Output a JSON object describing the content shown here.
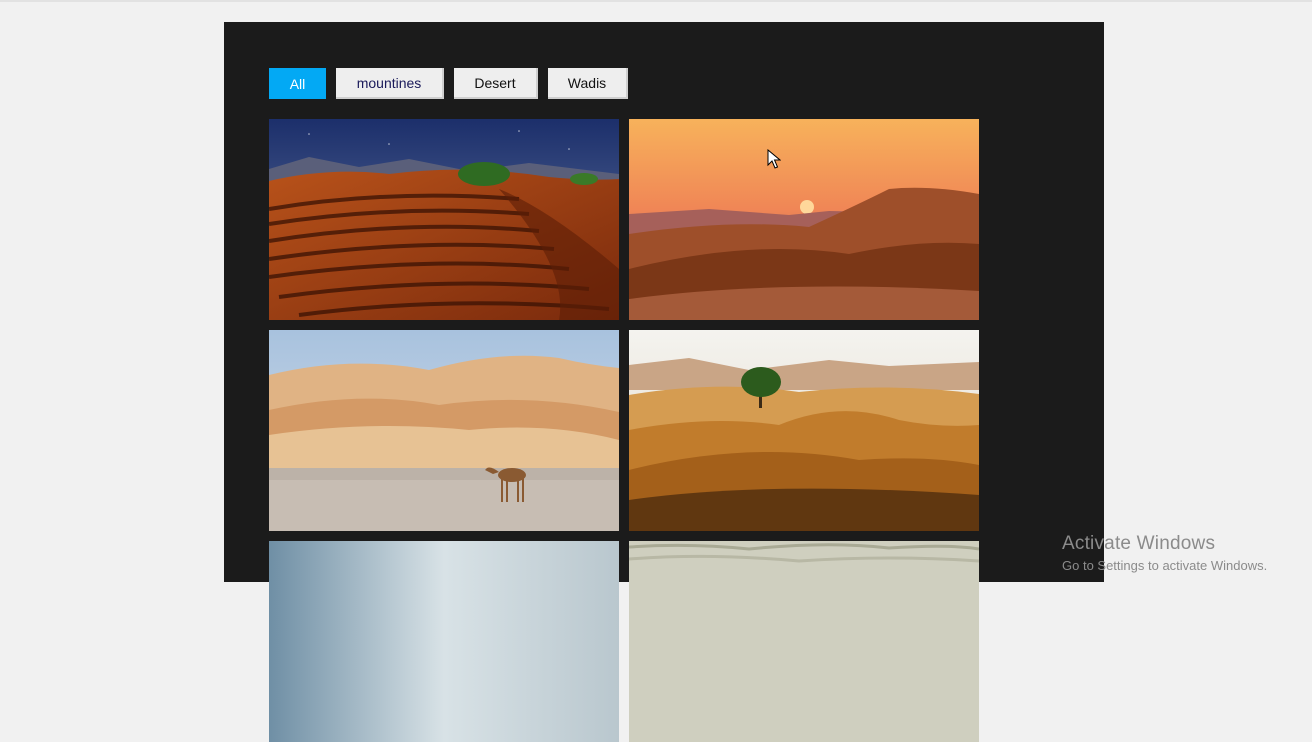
{
  "filters": {
    "all": "All",
    "mountains": "mountines",
    "desert": "Desert",
    "wadis": "Wadis"
  },
  "gallery": {
    "photos": [
      {
        "subject": "rippled-dunes-night"
      },
      {
        "subject": "dunes-sunset"
      },
      {
        "subject": "dunes-with-camel"
      },
      {
        "subject": "dunes-with-tree"
      },
      {
        "subject": "desert-haze"
      },
      {
        "subject": "pale-dunes"
      }
    ]
  },
  "watermark": {
    "line1": "Activate Windows",
    "line2": "Go to Settings to activate Windows."
  },
  "colors": {
    "accent": "#03a9f4",
    "panel": "#1b1b1b",
    "page": "#f1f1f1"
  }
}
